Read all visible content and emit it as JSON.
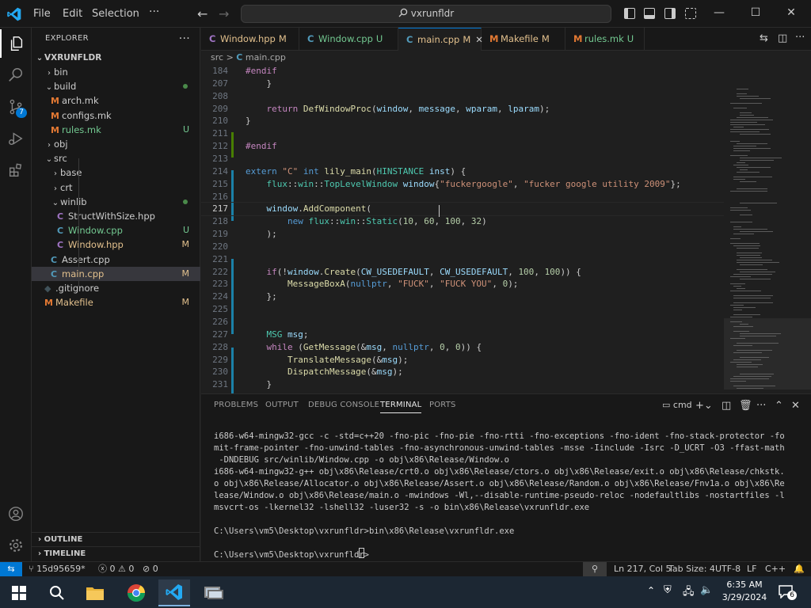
{
  "titlebar": {
    "menus": [
      "File",
      "Edit",
      "Selection"
    ],
    "more": "···",
    "search": "vxrunfldr"
  },
  "activity": {
    "scm_badge": "7"
  },
  "sidebar": {
    "title": "EXPLORER",
    "root": "VXRUNFLDR",
    "items": [
      {
        "label": "bin",
        "indent": 1,
        "kind": "folder",
        "open": false,
        "status": ""
      },
      {
        "label": "build",
        "indent": 1,
        "kind": "folder",
        "open": true,
        "status": "dot"
      },
      {
        "label": "arch.mk",
        "indent": 2,
        "kind": "mk",
        "status": ""
      },
      {
        "label": "configs.mk",
        "indent": 2,
        "kind": "mk",
        "status": ""
      },
      {
        "label": "rules.mk",
        "indent": 2,
        "kind": "mk",
        "status": "U"
      },
      {
        "label": "obj",
        "indent": 1,
        "kind": "folder",
        "open": false,
        "status": ""
      },
      {
        "label": "src",
        "indent": 1,
        "kind": "folder",
        "open": true,
        "status": ""
      },
      {
        "label": "base",
        "indent": 2,
        "kind": "folder",
        "open": false,
        "status": ""
      },
      {
        "label": "crt",
        "indent": 2,
        "kind": "folder",
        "open": false,
        "status": ""
      },
      {
        "label": "winlib",
        "indent": 2,
        "kind": "folder",
        "open": true,
        "status": "dot"
      },
      {
        "label": "StructWithSize.hpp",
        "indent": 3,
        "kind": "hpp",
        "status": ""
      },
      {
        "label": "Window.cpp",
        "indent": 3,
        "kind": "cpp",
        "status": "U"
      },
      {
        "label": "Window.hpp",
        "indent": 3,
        "kind": "hpp",
        "status": "M"
      },
      {
        "label": "Assert.cpp",
        "indent": 2,
        "kind": "cpp",
        "status": ""
      },
      {
        "label": "main.cpp",
        "indent": 2,
        "kind": "cpp",
        "status": "M"
      },
      {
        "label": ".gitignore",
        "indent": 1,
        "kind": "git",
        "status": ""
      },
      {
        "label": "Makefile",
        "indent": 1,
        "kind": "mk",
        "status": "M"
      }
    ],
    "outline": "OUTLINE",
    "timeline": "TIMELINE"
  },
  "tabs": [
    {
      "label": "Window.hpp",
      "status": "M",
      "kind": "hpp"
    },
    {
      "label": "Window.cpp",
      "status": "U",
      "kind": "cpp"
    },
    {
      "label": "main.cpp",
      "status": "M",
      "kind": "cpp",
      "active": true
    },
    {
      "label": "Makefile",
      "status": "M",
      "kind": "mk"
    },
    {
      "label": "rules.mk",
      "status": "U",
      "kind": "mk"
    }
  ],
  "breadcrumb": {
    "folder": "src",
    "sep": ">",
    "file": "main.cpp"
  },
  "code": [
    {
      "n": "184",
      "html": "<span class='pp'>#endif</span>"
    },
    {
      "n": "207",
      "html": "    }"
    },
    {
      "n": "208",
      "html": ""
    },
    {
      "n": "209",
      "html": "    <span class='kc'>return</span> <span class='f'>DefWindowProc</span>(<span class='v'>window</span>, <span class='v'>message</span>, <span class='v'>wparam</span>, <span class='v'>lparam</span>);"
    },
    {
      "n": "210",
      "html": "}"
    },
    {
      "n": "211",
      "html": ""
    },
    {
      "n": "212",
      "html": "<span class='pp'>#endif</span>"
    },
    {
      "n": "213",
      "html": ""
    },
    {
      "n": "214",
      "html": "<span class='k'>extern</span> <span class='s'>\"C\"</span> <span class='k'>int</span> <span class='f'>lily_main</span>(<span class='t'>HINSTANCE</span> <span class='v'>inst</span>) {"
    },
    {
      "n": "215",
      "html": "    <span class='t'>flux</span>::<span class='t'>win</span>::<span class='t'>TopLevelWindow</span> <span class='v'>window</span>{<span class='s'>\"fuckergoogle\"</span>, <span class='s'>\"fucker google utility 2009\"</span>};"
    },
    {
      "n": "216",
      "html": ""
    },
    {
      "n": "217",
      "html": "    <span class='v'>window</span>.<span class='f'>AddComponent</span>(",
      "cur": true
    },
    {
      "n": "218",
      "html": "        <span class='k'>new</span> <span class='t'>flux</span>::<span class='t'>win</span>::<span class='t'>Static</span>(<span class='n'>10</span>, <span class='n'>60</span>, <span class='n'>100</span>, <span class='n'>32</span>)"
    },
    {
      "n": "219",
      "html": "    );"
    },
    {
      "n": "220",
      "html": ""
    },
    {
      "n": "221",
      "html": ""
    },
    {
      "n": "222",
      "html": "    <span class='kc'>if</span>(!<span class='v'>window</span>.<span class='f'>Create</span>(<span class='v'>CW_USEDEFAULT</span>, <span class='v'>CW_USEDEFAULT</span>, <span class='n'>100</span>, <span class='n'>100</span>)) {"
    },
    {
      "n": "223",
      "html": "        <span class='f'>MessageBoxA</span>(<span class='k'>nullptr</span>, <span class='s'>\"FUCK\"</span>, <span class='s'>\"FUCK YOU\"</span>, <span class='n'>0</span>);"
    },
    {
      "n": "224",
      "html": "    };"
    },
    {
      "n": "225",
      "html": ""
    },
    {
      "n": "226",
      "html": ""
    },
    {
      "n": "227",
      "html": "    <span class='t'>MSG</span> <span class='v'>msg</span>;"
    },
    {
      "n": "228",
      "html": "    <span class='kc'>while</span> (<span class='f'>GetMessage</span>(&amp;<span class='v'>msg</span>, <span class='k'>nullptr</span>, <span class='n'>0</span>, <span class='n'>0</span>)) {"
    },
    {
      "n": "229",
      "html": "        <span class='f'>TranslateMessage</span>(&amp;<span class='v'>msg</span>);"
    },
    {
      "n": "230",
      "html": "        <span class='f'>DispatchMessage</span>(&amp;<span class='v'>msg</span>);"
    },
    {
      "n": "231",
      "html": "    }"
    }
  ],
  "panel": {
    "tabs": [
      "PROBLEMS",
      "OUTPUT",
      "DEBUG CONSOLE",
      "TERMINAL",
      "PORTS"
    ],
    "active": "TERMINAL",
    "shell": "cmd",
    "terminal": "i686-w64-mingw32-gcc -c -std=c++20 -fno-pic -fno-pie -fno-rtti -fno-exceptions -fno-ident -fno-stack-protector -fo\nmit-frame-pointer -fno-unwind-tables -fno-asynchronous-unwind-tables -msse -Iinclude -Isrc -D_UCRT -O3 -ffast-math\n -DNDEBUG src/winlib/Window.cpp -o obj\\x86\\Release/Window.o\ni686-w64-mingw32-g++ obj\\x86\\Release/crt0.o obj\\x86\\Release/ctors.o obj\\x86\\Release/exit.o obj\\x86\\Release/chkstk.\no obj\\x86\\Release/Allocator.o obj\\x86\\Release/Assert.o obj\\x86\\Release/Random.o obj\\x86\\Release/Fnv1a.o obj\\x86\\Re\nlease/Window.o obj\\x86\\Release/main.o -mwindows -Wl,--disable-runtime-pseudo-reloc -nodefaultlibs -nostartfiles -l\nmsvcrt-os -lkernel32 -lshell32 -luser32 -s -o bin\\x86\\Release\\vxrunfldr.exe\n\nC:\\Users\\vm5\\Desktop\\vxrunfldr>bin\\x86\\Release\\vxrunfldr.exe\n\nC:\\Users\\vm5\\Desktop\\vxrunfldr>"
  },
  "statusbar": {
    "branch": "15d95659*",
    "errors": "0",
    "warnings": "0",
    "ports": "0",
    "position": "Ln 217, Col 5",
    "tabsize": "Tab Size: 4",
    "encoding": "UTF-8",
    "eol": "LF",
    "language": "C++"
  },
  "taskbar": {
    "time": "6:35 AM",
    "date": "3/29/2024",
    "notif": "6"
  },
  "colors": {
    "accent": "#0078d4",
    "modified": "#e2c08d",
    "untracked": "#73c991"
  }
}
